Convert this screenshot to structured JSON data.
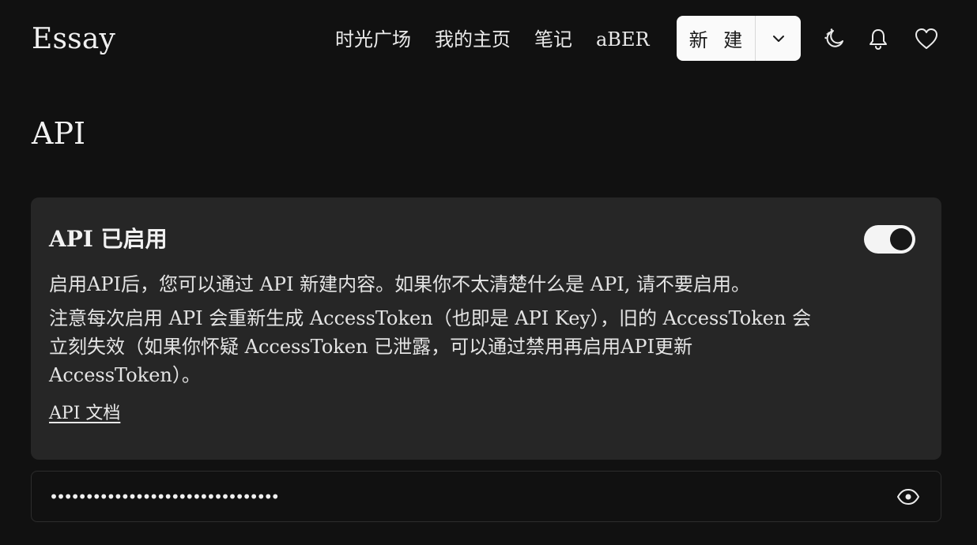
{
  "header": {
    "brand": "Essay",
    "nav": [
      {
        "label": "时光广场"
      },
      {
        "label": "我的主页"
      },
      {
        "label": "笔记"
      },
      {
        "label": "aBER"
      }
    ],
    "new_button_label": "新 建",
    "icons": {
      "dropdown": "chevron-down-icon",
      "theme": "moon-stars-icon",
      "notifications": "bell-icon",
      "favorites": "heart-icon"
    }
  },
  "page": {
    "title": "API"
  },
  "api_card": {
    "title": "API 已启用",
    "enabled": true,
    "description_1": "启用API后，您可以通过 API 新建内容。如果你不太清楚什么是 API, 请不要启用。",
    "description_2": "注意每次启用 API 会重新生成 AccessToken（也即是 API Key），旧的 AccessToken 会立刻失效（如果你怀疑 AccessToken 已泄露，可以通过禁用再启用API更新 AccessToken）。",
    "doc_link": "API 文档"
  },
  "token": {
    "value": "••••••••••••••••••••••••••••••••",
    "visibility_icon": "eye-icon"
  },
  "colors": {
    "background": "#111111",
    "card": "#262626",
    "text": "#ececec",
    "button_bg": "#fafafa"
  }
}
